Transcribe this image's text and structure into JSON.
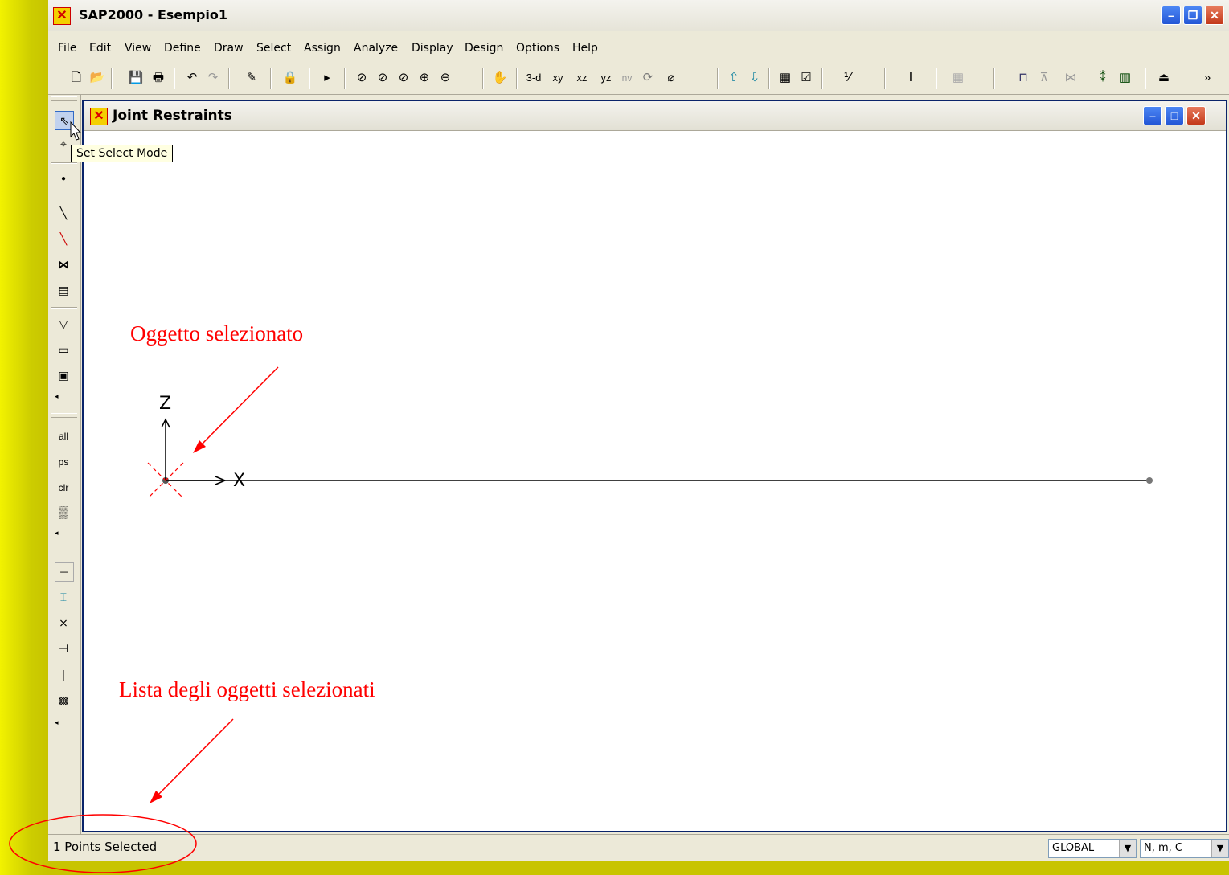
{
  "app": {
    "title": "SAP2000 - Esempio1",
    "menu": [
      "File",
      "Edit",
      "View",
      "Define",
      "Draw",
      "Select",
      "Assign",
      "Analyze",
      "Display",
      "Design",
      "Options",
      "Help"
    ]
  },
  "toolbar": {
    "view_labels": [
      "3-d",
      "xy",
      "xz",
      "yz",
      "nv"
    ]
  },
  "left_toolbar": {
    "select_all": "all",
    "previous_selection": "ps",
    "clear_selection": "clr"
  },
  "tooltip": "Set Select Mode",
  "child_window": {
    "title": "Joint Restraints"
  },
  "model": {
    "axis_z": "Z",
    "axis_x": "X"
  },
  "annotations": {
    "selected_object": "Oggetto selezionato",
    "selection_list": "Lista degli oggetti selezionati"
  },
  "status": {
    "text": "1 Points Selected",
    "coord_system": "GLOBAL",
    "units": "N, m, C"
  },
  "colors": {
    "annotation": "#ff0000",
    "background_accent": "#cccc00"
  }
}
